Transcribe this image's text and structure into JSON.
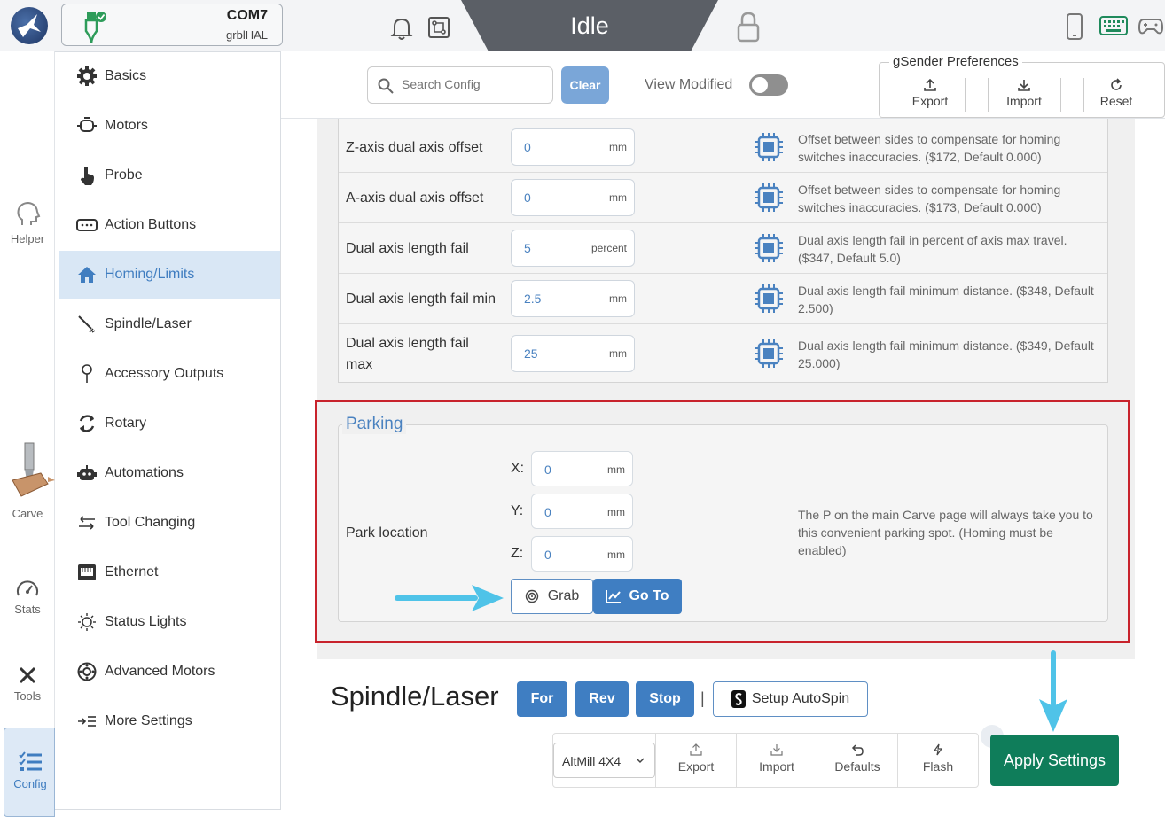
{
  "connection": {
    "port": "COM7",
    "firmware": "grblHAL"
  },
  "status": {
    "text": "Idle"
  },
  "rail": {
    "helper": "Helper",
    "carve": "Carve",
    "stats": "Stats",
    "tools": "Tools",
    "config": "Config"
  },
  "sidebar": {
    "items": [
      {
        "label": "Basics",
        "icon": "gear-icon"
      },
      {
        "label": "Motors",
        "icon": "motor-icon"
      },
      {
        "label": "Probe",
        "icon": "probe-hand-icon"
      },
      {
        "label": "Action Buttons",
        "icon": "action-buttons-icon"
      },
      {
        "label": "Homing/Limits",
        "icon": "home-icon"
      },
      {
        "label": "Spindle/Laser",
        "icon": "spindle-icon"
      },
      {
        "label": "Accessory Outputs",
        "icon": "pin-icon"
      },
      {
        "label": "Rotary",
        "icon": "rotary-icon"
      },
      {
        "label": "Automations",
        "icon": "robot-icon"
      },
      {
        "label": "Tool Changing",
        "icon": "swap-icon"
      },
      {
        "label": "Ethernet",
        "icon": "ethernet-icon"
      },
      {
        "label": "Status Lights",
        "icon": "light-icon"
      },
      {
        "label": "Advanced Motors",
        "icon": "advanced-motor-icon"
      },
      {
        "label": "More Settings",
        "icon": "list-arrow-icon"
      }
    ],
    "active_index": 4
  },
  "toolbar": {
    "search_placeholder": "Search Config",
    "clear_label": "Clear",
    "view_modified_label": "View Modified",
    "view_modified_on": false
  },
  "preferences": {
    "title": "gSender Preferences",
    "export": "Export",
    "import": "Import",
    "reset": "Reset"
  },
  "settings": [
    {
      "label": "Z-axis dual axis offset",
      "value": "0",
      "unit": "mm",
      "desc": "Offset between sides to compensate for homing switches inaccuracies. ($172, Default 0.000)"
    },
    {
      "label": "A-axis dual axis offset",
      "value": "0",
      "unit": "mm",
      "desc": "Offset between sides to compensate for homing switches inaccuracies. ($173, Default 0.000)"
    },
    {
      "label": "Dual axis length fail",
      "value": "5",
      "unit": "percent",
      "desc": "Dual axis length fail in percent of axis max travel. ($347, Default 5.0)"
    },
    {
      "label": "Dual axis length fail min",
      "value": "2.5",
      "unit": "mm",
      "desc": "Dual axis length fail minimum distance. ($348, Default 2.500)"
    },
    {
      "label": "Dual axis length fail max",
      "value": "25",
      "unit": "mm",
      "desc": "Dual axis length fail minimum distance. ($349, Default 25.000)"
    }
  ],
  "parking": {
    "title": "Parking",
    "label": "Park location",
    "x_label": "X:",
    "x_value": "0",
    "y_label": "Y:",
    "y_value": "0",
    "z_label": "Z:",
    "z_value": "0",
    "unit": "mm",
    "desc": "The P on the main Carve page will always take you to this convenient parking spot. (Homing must be enabled)",
    "grab_label": "Grab",
    "goto_label": "Go To"
  },
  "spindle": {
    "title": "Spindle/Laser",
    "for_label": "For",
    "rev_label": "Rev",
    "stop_label": "Stop",
    "separator": "|",
    "autospin_label": "Setup AutoSpin"
  },
  "bottom": {
    "machine": "AltMill 4X4",
    "export": "Export",
    "import": "Import",
    "defaults": "Defaults",
    "flash": "Flash",
    "apply": "Apply Settings"
  },
  "colors": {
    "accent": "#3f7ec2",
    "apply_green": "#0f7d5a",
    "highlight_red": "#c8232c",
    "callout_arrow": "#4fc3e8",
    "status_bg": "#5b5f66"
  }
}
